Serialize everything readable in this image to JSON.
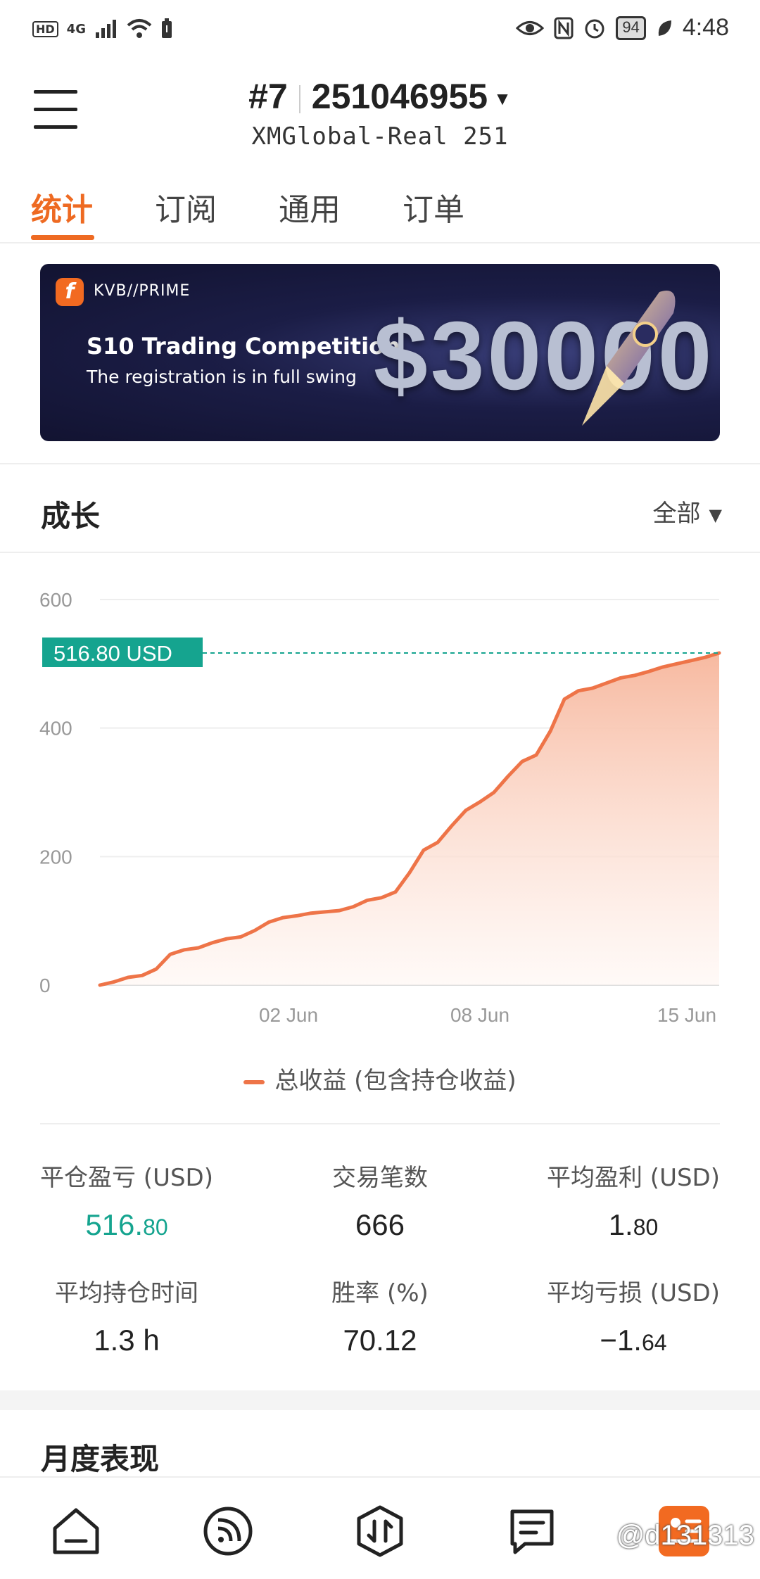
{
  "status_bar": {
    "left_icons": [
      "HD",
      "4G",
      "signal-icon",
      "wifi-icon",
      "battery-saver-icon"
    ],
    "battery": "94",
    "time": "4:48"
  },
  "header": {
    "account_index": "#7",
    "account_number": "251046955",
    "server": "XMGlobal-Real 251"
  },
  "tabs": [
    "统计",
    "订阅",
    "通用",
    "订单"
  ],
  "active_tab": 0,
  "banner": {
    "brand": "KVB//PRIME",
    "title": "S10 Trading Competition",
    "subtitle": "The registration is in full swing",
    "amount": "$30000"
  },
  "growth": {
    "title": "成长",
    "filter": "全部"
  },
  "chart_data": {
    "type": "area",
    "y_ticks": [
      "600",
      "400",
      "200",
      "0"
    ],
    "ylim": [
      0,
      600
    ],
    "x_ticks": [
      "02 Jun",
      "08 Jun",
      "15 Jun"
    ],
    "current_value_label": "516.80 USD",
    "current_value": 516.8,
    "legend": "总收益 (包含持仓收益)",
    "series": [
      {
        "values": [
          0,
          5,
          12,
          15,
          25,
          48,
          55,
          58,
          66,
          72,
          75,
          85,
          98,
          105,
          108,
          112,
          114,
          116,
          122,
          132,
          136,
          145,
          175,
          210,
          222,
          248,
          272,
          285,
          300,
          325,
          348,
          358,
          395,
          445,
          458,
          462,
          470,
          478,
          482,
          488,
          495,
          500,
          505,
          510,
          516.8
        ]
      }
    ],
    "colors": {
      "line": "#ee7448",
      "fill_top": "#f7b9a0",
      "fill_bottom": "#fff6f2",
      "marker": "#15a48f"
    }
  },
  "stats": [
    {
      "label": "平仓盈亏 (USD)",
      "value_int": "516.",
      "value_dec": "80",
      "color": "green"
    },
    {
      "label": "交易笔数",
      "value_int": "666",
      "value_dec": ""
    },
    {
      "label": "平均盈利 (USD)",
      "value_int": "1.",
      "value_dec": "80"
    },
    {
      "label": "平均持仓时间",
      "value_int": "1.3 h",
      "value_dec": ""
    },
    {
      "label": "胜率 (%)",
      "value_int": "70.12",
      "value_dec": ""
    },
    {
      "label": "平均亏损 (USD)",
      "value_int": "−1.",
      "value_dec": "64"
    }
  ],
  "monthly": {
    "title": "月度表现"
  },
  "bottom_nav": [
    "home-icon",
    "feed-icon",
    "trade-icon",
    "message-icon",
    "profile-icon"
  ],
  "watermark": "@d131313"
}
